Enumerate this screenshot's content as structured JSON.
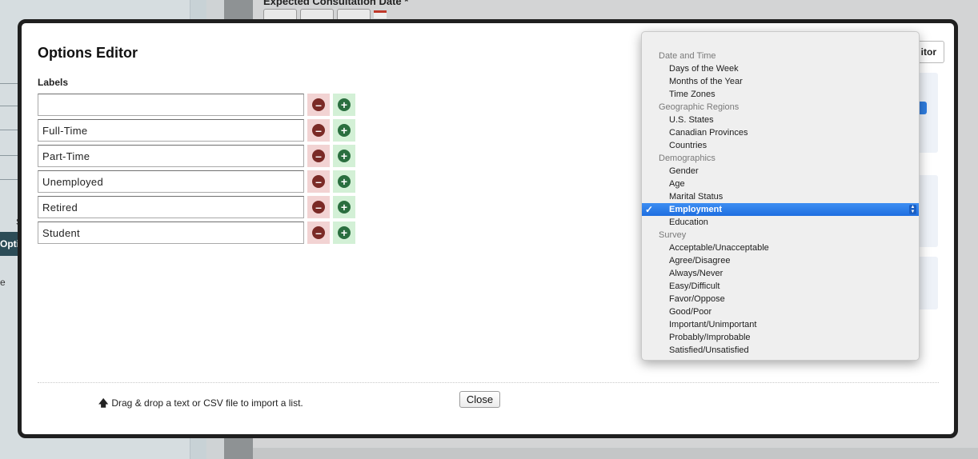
{
  "background": {
    "field_label": "Expected Consultation Date *",
    "side_tab": "Opti",
    "side_letter_e": "e",
    "side_letter_s": "S"
  },
  "modal": {
    "title": "Options Editor",
    "labels_heading": "Labels",
    "options": [
      {
        "value": ""
      },
      {
        "value": "Full-Time"
      },
      {
        "value": "Part-Time"
      },
      {
        "value": "Unemployed"
      },
      {
        "value": "Retired"
      },
      {
        "value": "Student"
      }
    ],
    "remove_symbol": "–",
    "add_symbol": "+",
    "drag_hint": "Drag & drop a text or CSV file to import a list.",
    "close_label": "Close",
    "editor_button_partial": "itor"
  },
  "dropdown": {
    "groups": [
      {
        "label": "Date and Time",
        "items": [
          "Days of the Week",
          "Months of the Year",
          "Time Zones"
        ]
      },
      {
        "label": "Geographic Regions",
        "items": [
          "U.S. States",
          "Canadian Provinces",
          "Countries"
        ]
      },
      {
        "label": "Demographics",
        "items": [
          "Gender",
          "Age",
          "Marital Status",
          "Employment",
          "Education"
        ]
      },
      {
        "label": "Survey",
        "items": [
          "Acceptable/Unacceptable",
          "Agree/Disagree",
          "Always/Never",
          "Easy/Difficult",
          "Favor/Oppose",
          "Good/Poor",
          "Important/Unimportant",
          "Probably/Improbable",
          "Satisfied/Unsatisfied"
        ]
      }
    ],
    "selected": "Employment",
    "check_symbol": "✓"
  },
  "colors": {
    "selection": "#1e6ee0",
    "remove_bg": "#f2d3d3",
    "add_bg": "#d3f0d6"
  }
}
